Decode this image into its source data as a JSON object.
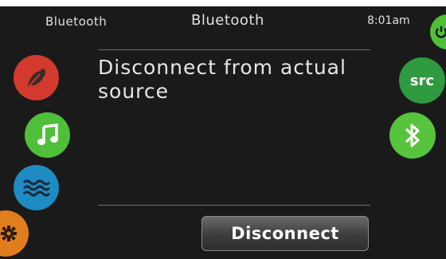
{
  "header": {
    "left_label": "Bluetooth",
    "title": "Bluetooth",
    "time": "8:01am"
  },
  "main": {
    "message": "Disconnect from actual source",
    "disconnect_label": "Disconnect"
  },
  "left_nav": [
    {
      "icon": "leaf-drop-icon",
      "color": "#d13a2d"
    },
    {
      "icon": "music-note-icon",
      "color": "#4fbf3a"
    },
    {
      "icon": "water-waves-icon",
      "color": "#1e8bc3"
    },
    {
      "icon": "gear-icon",
      "color": "#e27d1d"
    }
  ],
  "right_nav": [
    {
      "icon": "power-icon",
      "color": "#4fbf3a"
    },
    {
      "label": "src",
      "color": "#2f9a3f"
    },
    {
      "icon": "bluetooth-icon",
      "color": "#57c43d"
    }
  ],
  "colors": {
    "background": "#1a1a1a",
    "divider": "#4a8a3a",
    "text": "#e0e0e0"
  }
}
